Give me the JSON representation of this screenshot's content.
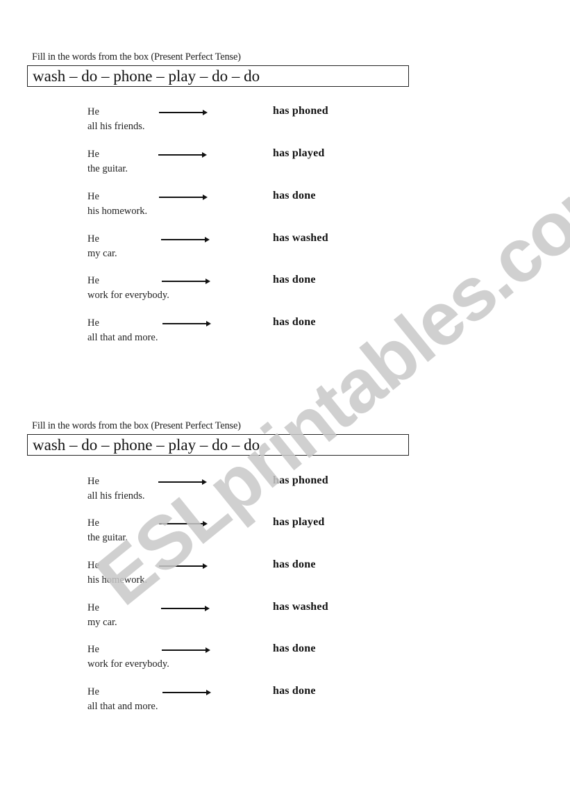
{
  "worksheet": {
    "sections": [
      {
        "instruction": "Fill in the words from the box (Present Perfect Tense)",
        "word_box": "wash – do – phone – play – do – do",
        "items": [
          {
            "subject": "He",
            "continuation": "all his friends.",
            "answer": "has phoned"
          },
          {
            "subject": "He",
            "continuation": "the guitar.",
            "answer": "has played"
          },
          {
            "subject": "He",
            "continuation": "his homework.",
            "answer": "has done"
          },
          {
            "subject": "He",
            "continuation": "my car.",
            "answer": "has washed"
          },
          {
            "subject": "He",
            "continuation": "work for everybody.",
            "answer": "has done"
          },
          {
            "subject": "He",
            "continuation": "all that and more.",
            "answer": "has done"
          }
        ]
      },
      {
        "instruction": "Fill in the words from the box (Present Perfect Tense)",
        "word_box": "wash – do – phone – play – do – do",
        "items": [
          {
            "subject": "He",
            "continuation": "all his friends.",
            "answer": "has phoned"
          },
          {
            "subject": "He",
            "continuation": "the guitar.",
            "answer": "has played"
          },
          {
            "subject": "He",
            "continuation": "his homework.",
            "answer": "has done"
          },
          {
            "subject": "He",
            "continuation": "my car.",
            "answer": "has washed"
          },
          {
            "subject": "He",
            "continuation": "work for everybody.",
            "answer": "has done"
          },
          {
            "subject": "He",
            "continuation": "all that and more.",
            "answer": "has done"
          }
        ]
      }
    ]
  },
  "watermark": {
    "text": "ESLprintables.com",
    "color": "#c8c8c8"
  }
}
